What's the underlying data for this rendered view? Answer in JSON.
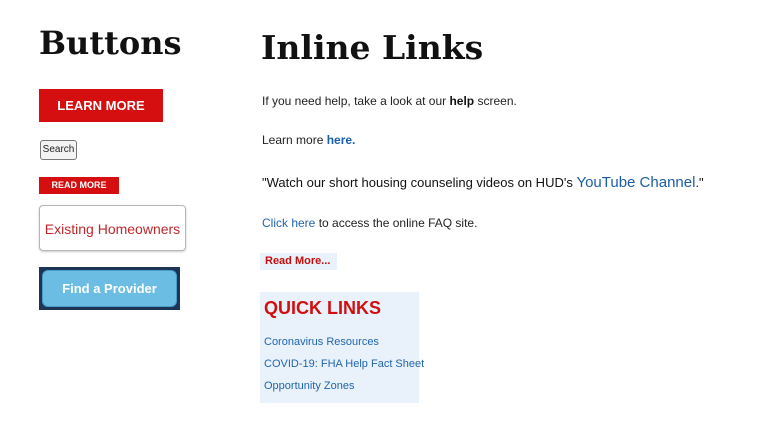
{
  "left": {
    "heading": "Buttons",
    "learn_more": "LEARN MORE",
    "search": "Search",
    "read_more_small": "READ MORE",
    "existing_homeowners": "Existing Homeowners",
    "find_provider": "Find a Provider"
  },
  "right": {
    "heading": "Inline Links",
    "help_line": {
      "before": "If you need help, take a look at our ",
      "bold": "help",
      "after": " screen."
    },
    "learn_line": {
      "before": "Learn more ",
      "link": "here."
    },
    "watch_line": {
      "before": "\"Watch our short housing counseling videos on HUD's ",
      "link": "YouTube Channel",
      "after": ".\""
    },
    "faq_line": {
      "link": "Click here",
      "after": " to access the online FAQ site."
    },
    "read_more": "Read More...",
    "quick_links": {
      "title": "QUICK LINKS",
      "items": [
        "Coronavirus Resources",
        "COVID-19: FHA Help Fact Sheet",
        "Opportunity Zones"
      ]
    }
  },
  "colors": {
    "red": "#d50f0f",
    "link_blue": "#1a5ea8",
    "panel_bg": "#e9f2fa",
    "provider_blue": "#6bbde3",
    "provider_navy": "#1c3557"
  }
}
